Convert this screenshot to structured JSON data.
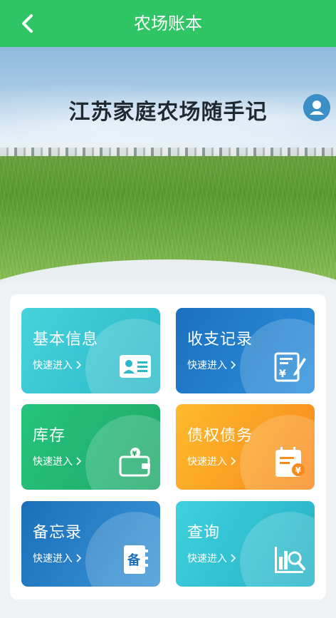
{
  "nav": {
    "title": "农场账本",
    "back_icon": "chevron-left-icon"
  },
  "hero": {
    "headline": "江苏家庭农场随手记",
    "avatar_icon": "user-avatar-icon"
  },
  "cards": [
    {
      "label": "基本信息",
      "enter": "快速进入",
      "icon": "id-card-icon",
      "colors": [
        "#46d2dc",
        "#2bb8c8"
      ]
    },
    {
      "label": "收支记录",
      "enter": "快速进入",
      "icon": "ledger-yen-edit-icon",
      "colors": [
        "#1c71be",
        "#2a8edb"
      ]
    },
    {
      "label": "库存",
      "enter": "快速进入",
      "icon": "wallet-yen-icon",
      "colors": [
        "#25c47d",
        "#1fa868"
      ]
    },
    {
      "label": "债权债务",
      "enter": "快速进入",
      "icon": "calendar-yen-icon",
      "colors": [
        "#fdba2c",
        "#f8891d"
      ]
    },
    {
      "label": "备忘录",
      "enter": "快速进入",
      "icon": "notebook-icon",
      "colors": [
        "#1b6fba",
        "#3a95d8"
      ]
    },
    {
      "label": "查询",
      "enter": "快速进入",
      "icon": "chart-search-icon",
      "colors": [
        "#3fd0dd",
        "#25b1c6"
      ]
    }
  ],
  "colors": {
    "header": "#2fc564",
    "page_bg": "#eef2f4"
  },
  "icon_text": {
    "notebook": "备",
    "yen": "¥"
  }
}
